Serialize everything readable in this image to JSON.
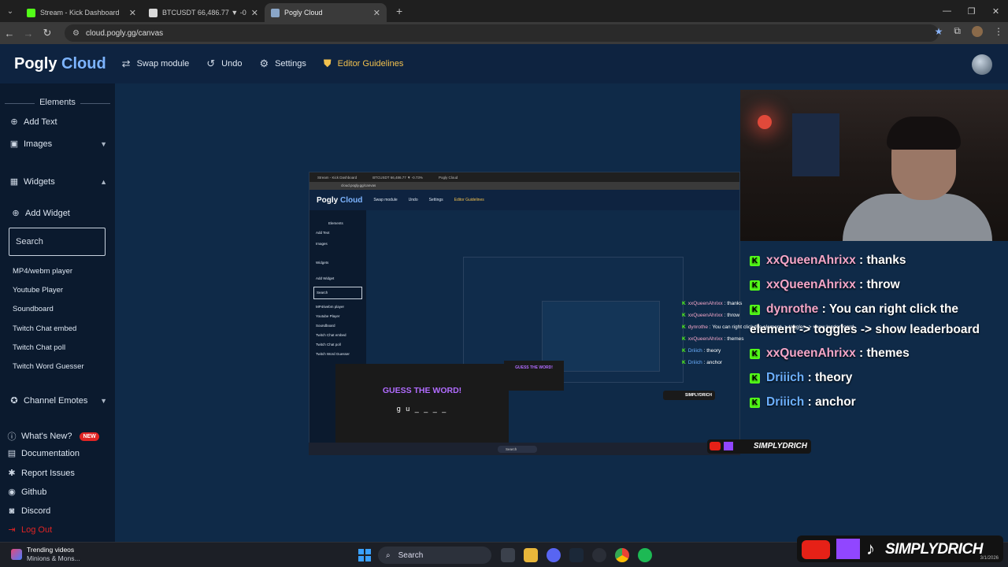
{
  "browser": {
    "tabs": [
      {
        "title": "Stream - Kick Dashboard",
        "fav_color": "#53fc18"
      },
      {
        "title": "BTCUSDT 66,486.77 ▼ -0.73% |",
        "fav_color": "#d9d9d9"
      },
      {
        "title": "Pogly Cloud",
        "fav_color": "#8aa6c8"
      }
    ],
    "url": "cloud.pogly.gg/canvas"
  },
  "header": {
    "logo_main": "Pogly",
    "logo_accent": "Cloud",
    "swap": "Swap module",
    "undo": "Undo",
    "settings": "Settings",
    "guidelines": "Editor Guidelines"
  },
  "sidebar": {
    "elements_title": "Elements",
    "add_text": "Add Text",
    "images": "Images",
    "widgets": "Widgets",
    "add_widget": "Add Widget",
    "search_placeholder": "Search",
    "widget_list": [
      "MP4/webm player",
      "Youtube Player",
      "Soundboard",
      "Twitch Chat embed",
      "Twitch Chat poll",
      "Twitch Word Guesser"
    ],
    "channel_emotes": "Channel Emotes",
    "whats_new": "What's New?",
    "new_badge": "NEW",
    "documentation": "Documentation",
    "report_issues": "Report Issues",
    "github": "Github",
    "discord": "Discord",
    "logout": "Log Out"
  },
  "capture": {
    "tabs": [
      "Stream - Kick Dashboard",
      "BTCUSDT 66,486.77 ▼ -0.73%",
      "Pogly Cloud"
    ],
    "url": "cloud.pogly.gg/canvas",
    "guess_title": "GUESS THE WORD!",
    "guess_word": "g u _ _ _ _",
    "guess_small": "GUESS THE WORD!",
    "mini_search": "Search",
    "mini_chat": [
      {
        "user": "xxQueenAhrixx",
        "msg": "thanks",
        "color": "pink"
      },
      {
        "user": "xxQueenAhrixx",
        "msg": "throw",
        "color": "pink"
      },
      {
        "user": "dynrothe",
        "msg": "You can right click the element -> toggles -> show leaderboard",
        "color": "pink"
      },
      {
        "user": "xxQueenAhrixx",
        "msg": "themes",
        "color": "pink"
      },
      {
        "user": "Driiich",
        "msg": "theory",
        "color": "blue"
      },
      {
        "user": "Driiich",
        "msg": "anchor",
        "color": "blue"
      }
    ]
  },
  "chat": {
    "messages": [
      {
        "user": "xxQueenAhrixx",
        "msg": "thanks"
      },
      {
        "user": "xxQueenAhrixx",
        "msg": "throw"
      },
      {
        "user": "dynrothe",
        "msg": "You can right click the"
      },
      {
        "user": "",
        "msg": "element -> toggles -> show leaderboard"
      },
      {
        "user": "xxQueenAhrixx",
        "msg": "themes"
      },
      {
        "user": "Driiich",
        "msg": "theory"
      },
      {
        "user": "Driiich",
        "msg": "anchor"
      }
    ],
    "kick_badge": "K"
  },
  "overlay": {
    "brand": "SIMPLYDRICH"
  },
  "taskbar": {
    "news_title": "Trending videos",
    "news_sub": "Minions & Mons...",
    "search": "Search",
    "date": "3/1/2026"
  }
}
